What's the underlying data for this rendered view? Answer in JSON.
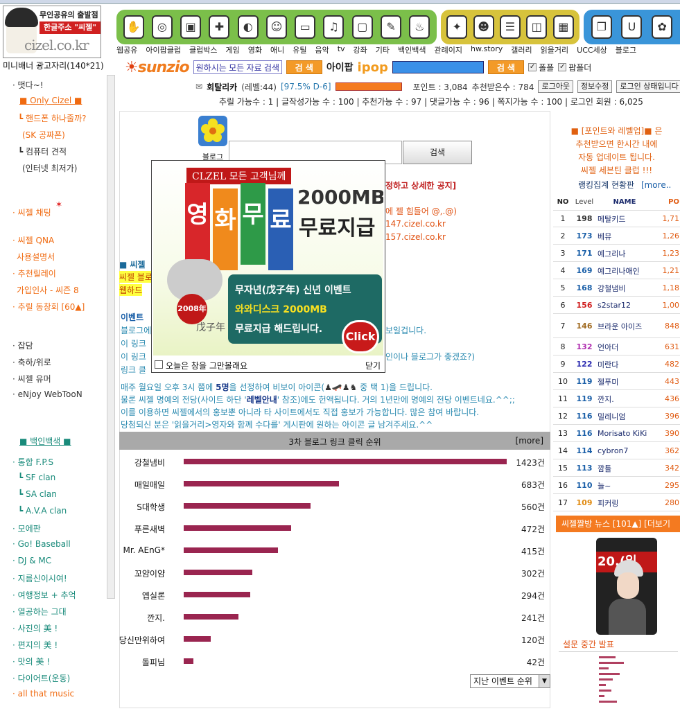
{
  "header": {
    "logo_line1": "무인공유의 출발점",
    "logo_line2": "한글주소 \"씨젤\"",
    "logo_domain": "cizel.co.kr",
    "ad_label": "미니배너 광고자리(140*21)",
    "nav_labels": [
      "웹공유",
      "아이팝클럽",
      "클럽박스",
      "게임",
      "영화",
      "애니",
      "유틸",
      "음악",
      "tv",
      "강좌",
      "기타",
      "백인백색",
      "관례이지",
      "hw.story",
      "갤러리",
      "읽을거리",
      "UCC세상",
      "블로그"
    ]
  },
  "searchbar": {
    "brand": "sunzio",
    "input_value": "원하시는 모든 자료 검색",
    "search_label": "검 색",
    "aipop_label": "아이팝",
    "ipop_label": "ipop",
    "search2_label": "검 색",
    "check1": "폴폴",
    "check2": "팝폴더"
  },
  "user": {
    "nickname": "회탈리카",
    "level": "(레벨:44)",
    "percent": "[97.5% D-6]",
    "points": "포인트 : 3,084",
    "recommended": "추천받은수 : 784",
    "logout": "로그아웃",
    "edit_info": "정보수정",
    "login_status": "로그인 상태입니다",
    "stats": "추릴 가능수 : 1 |  글작성가능 수 : 100 |  추천가능 수 : 97 |  댓글가능 수 : 96 |  쪽지가능 수 : 100 |  로그인 회원 : 6,025"
  },
  "leftnav": [
    {
      "label": "· 떳다~!",
      "color": "dk"
    },
    {
      "label": "■ Only Cizel ■",
      "color": "or"
    },
    {
      "label": "┗ 핸드폰 하나줄까?",
      "color": "or"
    },
    {
      "label": "(SK 공짜폰)",
      "color": "or"
    },
    {
      "label": "┗ 컴퓨터 견적",
      "color": "dk"
    },
    {
      "label": "(인터넷 최저가)",
      "color": "dk"
    },
    {
      "label": "· 씨젤 채팅",
      "color": "or"
    },
    {
      "label": "· 씨젤 QNA",
      "color": "or"
    },
    {
      "label": "사용설명서",
      "color": "or"
    },
    {
      "label": "· 추천릴레이",
      "color": "or"
    },
    {
      "label": "가입인사 - 씨즌 8",
      "color": "or"
    },
    {
      "label": "· 추릴 동창회 [60▲]",
      "color": "or"
    },
    {
      "label": "· 잡담",
      "color": "dk"
    },
    {
      "label": "· 축하/위로",
      "color": "dk"
    },
    {
      "label": "· 씨젤 유머",
      "color": "dk"
    },
    {
      "label": "· eNjoy WebTooN",
      "color": "dk"
    },
    {
      "label": "■ 백인백색 ■",
      "color": "tl"
    },
    {
      "label": "· 통합 F.P.S",
      "color": "tl"
    },
    {
      "label": "┗ SF clan",
      "color": "tl"
    },
    {
      "label": "┗ SA clan",
      "color": "tl"
    },
    {
      "label": "┗ A.V.A clan",
      "color": "tl"
    },
    {
      "label": "· 모에판",
      "color": "tl"
    },
    {
      "label": "· Go! Baseball",
      "color": "tl"
    },
    {
      "label": "· DJ & MC",
      "color": "tl"
    },
    {
      "label": "· 지름신이시여!",
      "color": "tl"
    },
    {
      "label": "· 여행정보 + 추억",
      "color": "tl"
    },
    {
      "label": "· 열공하는 그대",
      "color": "tl"
    },
    {
      "label": "· 사진의 美 !",
      "color": "tl"
    },
    {
      "label": "· 편지의 美 !",
      "color": "tl"
    },
    {
      "label": "· 맛의 美 !",
      "color": "tl"
    },
    {
      "label": "· 다이어트(운동)",
      "color": "tl"
    },
    {
      "label": "· all that music",
      "color": "or"
    }
  ],
  "blog": {
    "icon_label": "블로그",
    "search_button": "검색",
    "notice_right": "정하고 상세한 공지]",
    "line_hard": "에 젤 힘들어 @,.@)",
    "url1": "147.cizel.co.kr",
    "url2": "157.cizel.co.kr",
    "frag_cizel": "■ 씨젤",
    "frag_cizel_blog": "씨젤 블로",
    "frag_webhard": "웹하드",
    "frag_event": "이벤트",
    "frag_blog": "블로그에",
    "frag_link1": "이 링크",
    "frag_link2": "이 링크",
    "frag_linkclick": "링크 클",
    "frag_visible": "보일겁니다.",
    "frag_blog_good": "인이나 블로그가 좋겠죠?)",
    "event_line1a": "매주 월요일 오후 3시 쯤에 ",
    "event_line1b": "5명",
    "event_line1c": "을 선정하여 비보이 아이콘(",
    "event_line1d": " 중 택 1)을 드립니다.",
    "event_line2a": "물론 씨젤 명예의 전당(사이트 하단 '",
    "event_line2b": "레벨안내",
    "event_line2c": "' 참조)에도 헌액됩니다. 거의 1년만에 명예의 전당 이벤트네요.^^;;",
    "event_line3": "이를 이용하면 씨젤에서의 홍보뿐 아니라 타 사이트에서도 직접 홍보가 가능합니다. 많은 참여 바랍니다.",
    "event_line4": "당첨되신 분은 '읽을거리>영자와 함께 수다를' 게시판에 원하는 아이콘 글 남겨주세요.^^"
  },
  "popup": {
    "banner_top": "CLZEL 모든 고객님께",
    "big_chars": [
      "영",
      "화",
      "무",
      "료"
    ],
    "band_colors": [
      "#d8262a",
      "#f08a1c",
      "#2e9a48",
      "#2a5fb4"
    ],
    "size": "2000MB",
    "give": "무료지급",
    "badge": "2008年",
    "year_chars": "戊子年",
    "event1": "무자년(戊子年) 신년 이벤트",
    "event2": "와와디스크 2000MB",
    "event3": "무료지급 해드립니다.",
    "click": "Click",
    "checkbox_label": "오늘은 창을 그만볼래요",
    "close": "닫기"
  },
  "chart_data": {
    "type": "bar",
    "title": "3차 블로그 링크 클릭 순위",
    "more": "[more]",
    "categories": [
      "강철냄비",
      "매일매일",
      "S대학생",
      "푸른새벽",
      "Mr. AEnG*",
      "꼬얌이얌",
      "엡실론",
      "깐지.",
      "당신만위하여",
      "돌피님"
    ],
    "values": [
      1423,
      683,
      560,
      472,
      415,
      302,
      294,
      241,
      120,
      42
    ],
    "value_labels": [
      "1423건",
      "683건",
      "560건",
      "472건",
      "415건",
      "302건",
      "294건",
      "241건",
      "120건",
      "42건"
    ],
    "bar_color": "#9a2550",
    "xlim": [
      0,
      1423
    ]
  },
  "past_event_select": "지난 이벤트 순위",
  "rightcol": {
    "notice1": "■ [포인트와 레벨업]■ 은",
    "notice2": "추천받으면 한시간 내에",
    "notice3": "자동 업데이트 됩니다.",
    "notice4": "씨젤 세븐틴 클럽 !!!",
    "ranking_title": "랭킹집계 현황판",
    "ranking_more": "[more..",
    "col_no": "NO",
    "col_level": "Level",
    "col_name": "NAME",
    "col_point": "PO",
    "ranks": [
      {
        "no": "1",
        "level": "198",
        "name": "메탈키드",
        "point": "1,71",
        "lc": "#333"
      },
      {
        "no": "2",
        "level": "173",
        "name": "베뮤",
        "point": "1,26",
        "lc": "#1a5fa8"
      },
      {
        "no": "3",
        "level": "171",
        "name": "예그리나",
        "point": "1,23",
        "lc": "#1a5fa8"
      },
      {
        "no": "4",
        "level": "169",
        "name": "예그리나애인",
        "point": "1,21",
        "lc": "#1a5fa8"
      },
      {
        "no": "5",
        "level": "168",
        "name": "강철냄비",
        "point": "1,18",
        "lc": "#1a5fa8"
      },
      {
        "no": "6",
        "level": "156",
        "name": "s2star12",
        "point": "1,00",
        "lc": "#d02020"
      },
      {
        "no": "7",
        "level": "146",
        "name": "브라운 아이즈",
        "point": "848",
        "lc": "#a06a20"
      },
      {
        "no": "8",
        "level": "132",
        "name": "언아더",
        "point": "631",
        "lc": "#b030b0"
      },
      {
        "no": "9",
        "level": "122",
        "name": "미란다",
        "point": "482",
        "lc": "#2a2ab0"
      },
      {
        "no": "10",
        "level": "119",
        "name": "젤푸미",
        "point": "443",
        "lc": "#1a5fa8"
      },
      {
        "no": "11",
        "level": "119",
        "name": "깐지.",
        "point": "436",
        "lc": "#1a5fa8"
      },
      {
        "no": "12",
        "level": "116",
        "name": "밀레니엄",
        "point": "396",
        "lc": "#1a5fa8"
      },
      {
        "no": "13",
        "level": "116",
        "name": "Morisato KiKi",
        "point": "390",
        "lc": "#1a5fa8"
      },
      {
        "no": "14",
        "level": "114",
        "name": "cybron7",
        "point": "362",
        "lc": "#1a5fa8"
      },
      {
        "no": "15",
        "level": "113",
        "name": "깜틀",
        "point": "342",
        "lc": "#1a5fa8"
      },
      {
        "no": "16",
        "level": "110",
        "name": "늘~",
        "point": "295",
        "lc": "#1a5fa8"
      },
      {
        "no": "17",
        "level": "109",
        "name": "피커링",
        "point": "280",
        "lc": "#e08a10"
      }
    ],
    "news_bar": "씨젤짤방 뉴스 [101▲] [더보기",
    "photo_text": "20.(일",
    "poll": "설문 중간 발표"
  }
}
